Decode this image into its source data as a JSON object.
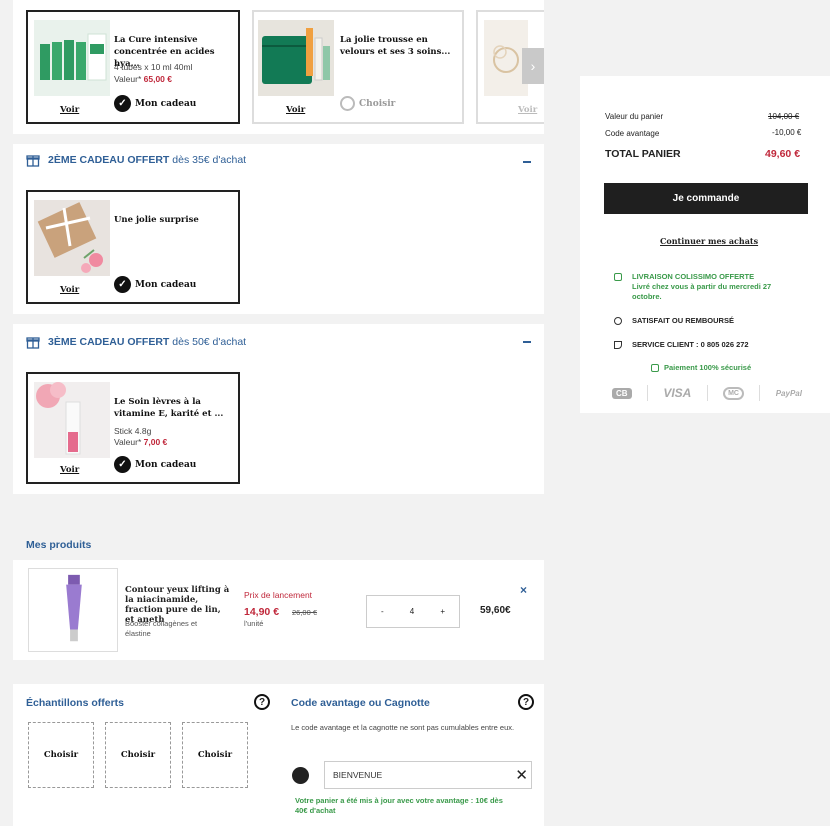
{
  "gifts_row1": [
    {
      "title": "La Cure intensive concentrée en acides hya...",
      "desc": "4 tubes x 10 ml 40ml",
      "value_label": "Valeur*",
      "value": "65,00 €",
      "voir": "Voir",
      "action": "Mon cadeau"
    },
    {
      "title": "La jolie trousse en velours et ses 3 soins...",
      "voir": "Voir",
      "action": "Choisir"
    },
    {
      "voir": "Voir"
    }
  ],
  "offer2": {
    "title": "2ÈME CADEAU OFFERT",
    "subtitle": "dès 35€ d'achat",
    "gift": {
      "title": "Une jolie surprise",
      "voir": "Voir",
      "action": "Mon cadeau"
    }
  },
  "offer3": {
    "title": "3ÈME CADEAU OFFERT",
    "subtitle": "dès 50€ d'achat",
    "gift": {
      "title": "Le Soin lèvres à la vitamine E, karité et ...",
      "desc": "Stick 4.8g",
      "value_label": "Valeur*",
      "value": "7,00 €",
      "voir": "Voir",
      "action": "Mon cadeau"
    }
  },
  "products": {
    "title": "Mes produits",
    "item": {
      "name": "Contour yeux lifting à la niacinamide, fraction pure de lin, et aneth",
      "desc": "Booster collagènes et élastine",
      "promo_label": "Prix de lancement",
      "price": "14,90 €",
      "old_price": "26,00 €",
      "unit": "l'unité",
      "qty": "4",
      "minus": "-",
      "plus": "+",
      "total": "59,60€",
      "remove": "×"
    }
  },
  "samples": {
    "title": "Échantillons offerts",
    "help": "?",
    "buttons": [
      "Choisir",
      "Choisir",
      "Choisir"
    ]
  },
  "promo": {
    "title": "Code avantage ou Cagnotte",
    "help": "?",
    "note": "Le code avantage et la cagnotte ne sont pas cumulables entre eux.",
    "code": "BIENVENUE",
    "clear": "✕",
    "success": "Votre panier a été mis à jour avec votre avantage : 10€ dès 40€ d'achat"
  },
  "summary": {
    "cart_value_label": "Valeur du panier",
    "cart_value": "104,00 €",
    "code_label": "Code avantage",
    "code_value": "-10,00 €",
    "total_label": "TOTAL PANIER",
    "total_value": "49,60 €",
    "order_button": "Je commande",
    "continue_link": "Continuer mes achats",
    "delivery_title": "LIVRAISON COLISSIMO OFFERTE",
    "delivery_sub": "Livré chez vous à partir du mercredi 27 octobre.",
    "satisfied": "SATISFAIT OU REMBOURSÉ",
    "service": "SERVICE CLIENT : 0 805 026 272",
    "secure": "Paiement 100% sécurisé",
    "payments": [
      "CB",
      "VISA",
      "MC",
      "PayPal"
    ]
  },
  "colors": {
    "accent": "#2f5f96",
    "price": "#c0283b",
    "success": "#3a9a4a",
    "button": "#1f1f1f"
  }
}
